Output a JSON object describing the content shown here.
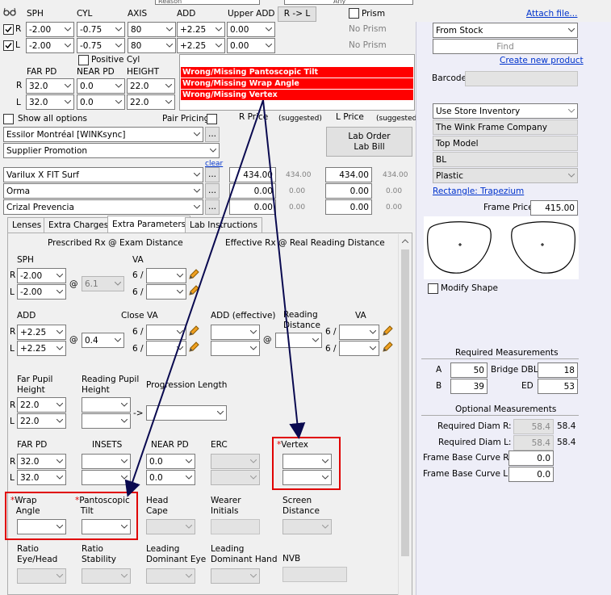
{
  "top": {
    "partial_field": "Reason",
    "partial_field2": "Any",
    "attach_file": "Attach file..."
  },
  "rx_header": {
    "sph": "SPH",
    "cyl": "CYL",
    "axis": "AXIS",
    "add": "ADD",
    "upper_add": "Upper ADD",
    "r_to_l": "R -> L",
    "prism": "Prism"
  },
  "rx_right": {
    "eye": "R",
    "sph": "-2.00",
    "cyl": "-0.75",
    "axis": "80",
    "add": "+2.25",
    "upper_add": "0.00",
    "prism": "No Prism"
  },
  "rx_left": {
    "eye": "L",
    "sph": "-2.00",
    "cyl": "-0.75",
    "axis": "80",
    "add": "+2.25",
    "upper_add": "0.00",
    "prism": "No Prism"
  },
  "positive_cyl": "Positive Cyl",
  "pd_header": {
    "far_pd": "FAR PD",
    "near_pd": "NEAR PD",
    "height": "HEIGHT"
  },
  "pd_right": {
    "eye": "R",
    "far_pd": "32.0",
    "near_pd": "0.0",
    "height": "22.0"
  },
  "pd_left": {
    "eye": "L",
    "far_pd": "32.0",
    "near_pd": "0.0",
    "height": "22.0"
  },
  "errors": [
    "Wrong/Missing Pantoscopic Tilt",
    "Wrong/Missing Wrap Angle",
    "Wrong/Missing Vertex"
  ],
  "options": {
    "show_all": "Show all options",
    "pair_pricing": "Pair Pricing",
    "r_price": "R Price",
    "suggested": "(suggested)",
    "l_price": "L Price",
    "lab_order": "Lab Order",
    "lab_bill": "Lab Bill",
    "clear": "clear",
    "ellipsis": "..."
  },
  "lab": "Essilor Montréal [WINKsync]",
  "supplier_promo": "Supplier Promotion",
  "lines": [
    {
      "name": "Varilux X FIT Surf",
      "r_price": "434.00",
      "r_sugg": "434.00",
      "l_price": "434.00",
      "l_sugg": "434.00"
    },
    {
      "name": "Orma",
      "r_price": "0.00",
      "r_sugg": "0.00",
      "l_price": "0.00",
      "l_sugg": "0.00"
    },
    {
      "name": "Crizal Prevencia",
      "r_price": "0.00",
      "r_sugg": "0.00",
      "l_price": "0.00",
      "l_sugg": "0.00"
    }
  ],
  "tabs": [
    "Lenses",
    "Extra Charges",
    "Extra Parameters",
    "Lab Instructions"
  ],
  "extra": {
    "prescribed": "Prescribed Rx @ Exam Distance",
    "effective": "Effective Rx @ Real Reading Distance",
    "sph": "SPH",
    "va": "VA",
    "r": "R",
    "l": "L",
    "at": "@",
    "sph_r": "-2.00",
    "sph_l": "-2.00",
    "va_val": "6.1",
    "six": "6 /",
    "add": "ADD",
    "close_va": "Close VA",
    "add_eff": "ADD (effective)",
    "reading_dist_1": "Reading",
    "reading_dist_2": "Distance",
    "add_r": "+2.25",
    "add_l": "+2.25",
    "close_va_val": "0.4",
    "far_pupil_1": "Far Pupil",
    "far_pupil_2": "Height",
    "reading_pupil_1": "Reading Pupil",
    "reading_pupil_2": "Height",
    "progression": "Progression Length",
    "arrow": "->",
    "fph_r": "22.0",
    "fph_l": "22.0",
    "far_pd": "FAR PD",
    "insets": "INSETS",
    "near_pd": "NEAR PD",
    "erc": "ERC",
    "vertex": "Vertex",
    "fpd_r": "32.0",
    "fpd_l": "32.0",
    "npd_r": "0.0",
    "npd_l": "0.0",
    "wrap_1": "Wrap",
    "wrap_2": "Angle",
    "panto_1": "Pantoscopic",
    "panto_2": "Tilt",
    "head_1": "Head",
    "head_2": "Cape",
    "wearer_1": "Wearer",
    "wearer_2": "Initials",
    "screen_1": "Screen",
    "screen_2": "Distance",
    "ratio_eh_1": "Ratio",
    "ratio_eh_2": "Eye/Head",
    "ratio_st_1": "Ratio",
    "ratio_st_2": "Stability",
    "lead_eye_1": "Leading",
    "lead_eye_2": "Dominant Eye",
    "lead_hand_1": "Leading",
    "lead_hand_2": "Dominant Hand",
    "nvb": "NVB",
    "required_star": "*"
  },
  "frame": {
    "source": "From Stock",
    "find": "Find",
    "create": "Create new product",
    "barcode": "Barcode",
    "inventory": "Use Store Inventory",
    "company": "The Wink Frame Company",
    "model": "Top Model",
    "color": "BL",
    "material": "Plastic",
    "shape": "Rectangle: Trapezium",
    "price_label": "Frame Price",
    "price": "415.00",
    "modify_shape": "Modify Shape"
  },
  "measurements": {
    "required_title": "Required Measurements",
    "a_label": "A",
    "a": "50",
    "bridge_label": "Bridge DBL",
    "bridge": "18",
    "b_label": "B",
    "b": "39",
    "ed_label": "ED",
    "ed": "53",
    "optional_title": "Optional Measurements",
    "diam_r_label": "Required Diam R:",
    "diam_r": "58.4",
    "diam_r_val": "58.4",
    "diam_l_label": "Required Diam L:",
    "diam_l": "58.4",
    "diam_l_val": "58.4",
    "fbc_r_label": "Frame Base Curve R:",
    "fbc_r": "0.0",
    "fbc_l_label": "Frame Base Curve L:",
    "fbc_l": "0.0"
  },
  "colors": {
    "error_red": "#ff0000",
    "annotation": "#0a0a50",
    "highlight": "#e00000",
    "link": "#0033cc"
  }
}
